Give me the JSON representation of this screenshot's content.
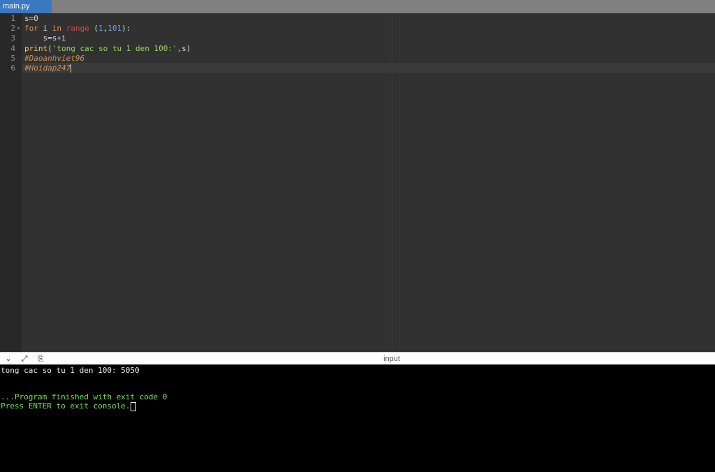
{
  "tab": {
    "filename": "main.py"
  },
  "editor": {
    "lines": [
      {
        "n": "1",
        "tokens": [
          [
            "op",
            "s"
          ],
          [
            "op",
            "=0"
          ]
        ]
      },
      {
        "n": "2",
        "fold": "▾",
        "tokens": [
          [
            "kw",
            "for"
          ],
          [
            "op",
            " i "
          ],
          [
            "kw",
            "in"
          ],
          [
            "op",
            " "
          ],
          [
            "builtin",
            "range"
          ],
          [
            "op",
            " ("
          ],
          [
            "num",
            "1"
          ],
          [
            "op",
            ","
          ],
          [
            "num",
            "101"
          ],
          [
            "op",
            "):"
          ]
        ]
      },
      {
        "n": "3",
        "tokens": [
          [
            "op",
            "    s=s+i"
          ]
        ]
      },
      {
        "n": "4",
        "tokens": [
          [
            "fn",
            "print"
          ],
          [
            "op",
            "("
          ],
          [
            "str",
            "'tong cac so tu 1 den 100:'"
          ],
          [
            "op",
            ",s)"
          ]
        ]
      },
      {
        "n": "5",
        "tokens": [
          [
            "cmt",
            "#Daoanhviet96"
          ]
        ]
      },
      {
        "n": "6",
        "tokens": [
          [
            "cmt",
            "#Hoidap247"
          ]
        ]
      }
    ]
  },
  "console_bar": {
    "title": "input",
    "icons": [
      "chevron-down-icon",
      "expand-icon",
      "copy-icon"
    ]
  },
  "console": {
    "output": "tong cac so tu 1 den 100: 5050",
    "finished": "...Program finished with exit code 0",
    "press_enter": "Press ENTER to exit console."
  }
}
